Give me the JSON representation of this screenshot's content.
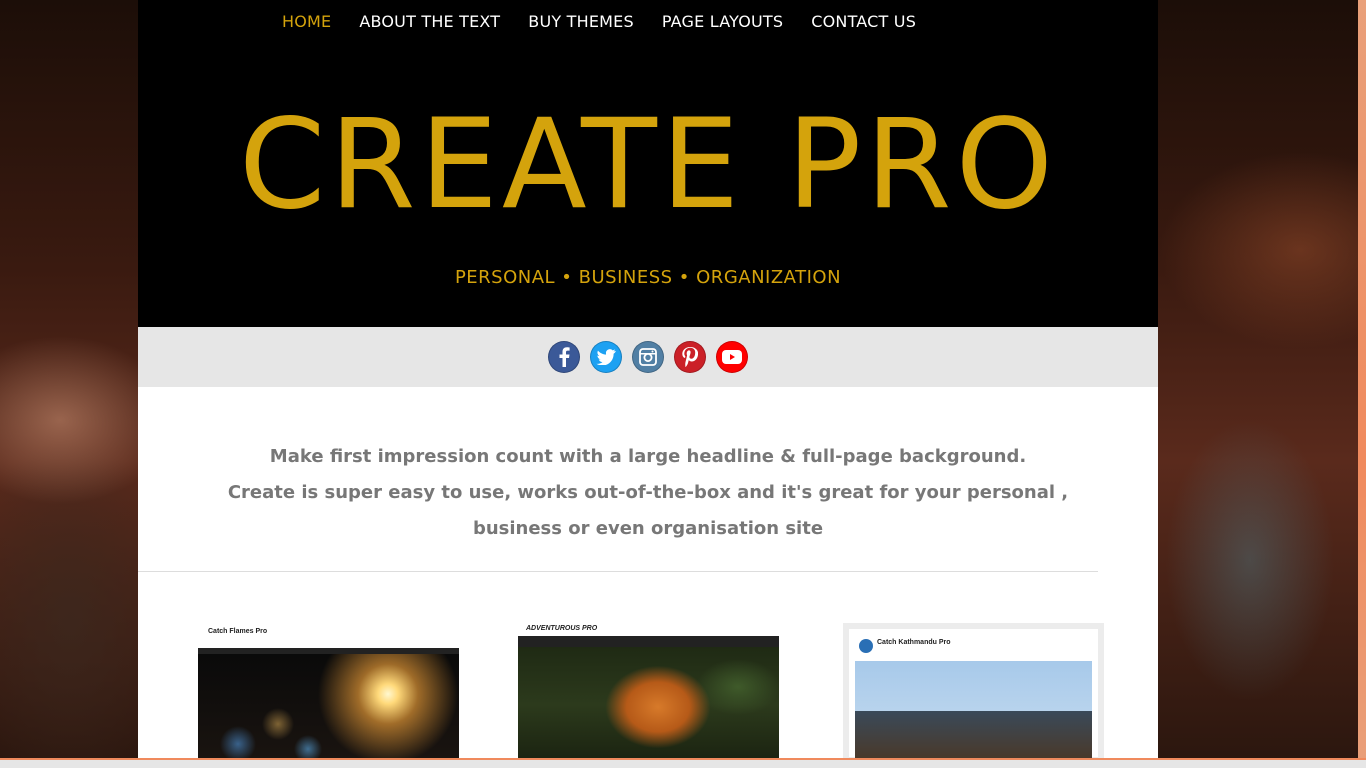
{
  "nav": {
    "items": [
      "HOME",
      "ABOUT THE TEXT",
      "BUY THEMES",
      "PAGE LAYOUTS",
      "CONTACT US"
    ],
    "active": "HOME"
  },
  "header": {
    "title": "CREATE PRO",
    "tagline": "PERSONAL • BUSINESS • ORGANIZATION"
  },
  "social": [
    {
      "name": "facebook-icon",
      "color": "#3b5998"
    },
    {
      "name": "twitter-icon",
      "color": "#1da1f2"
    },
    {
      "name": "instagram-icon",
      "color": "#517fa4"
    },
    {
      "name": "pinterest-icon",
      "color": "#cb2027"
    },
    {
      "name": "youtube-icon",
      "color": "#ff0000"
    }
  ],
  "intro": {
    "line1": "Make first impression count with a large headline & full-page background.",
    "line2": "Create is super easy to use, works out-of-the-box and it's great for your personal ,",
    "line3": "business or even organisation site"
  },
  "gallery": [
    {
      "title": "Catch Flames Pro"
    },
    {
      "title": "ADVENTUROUS PRO"
    },
    {
      "title": "Catch Kathmandu Pro"
    }
  ],
  "colors": {
    "accent": "#d4a30c",
    "header_bg": "#000000",
    "social_bar_bg": "#e6e6e6",
    "intro_text": "#777777"
  }
}
